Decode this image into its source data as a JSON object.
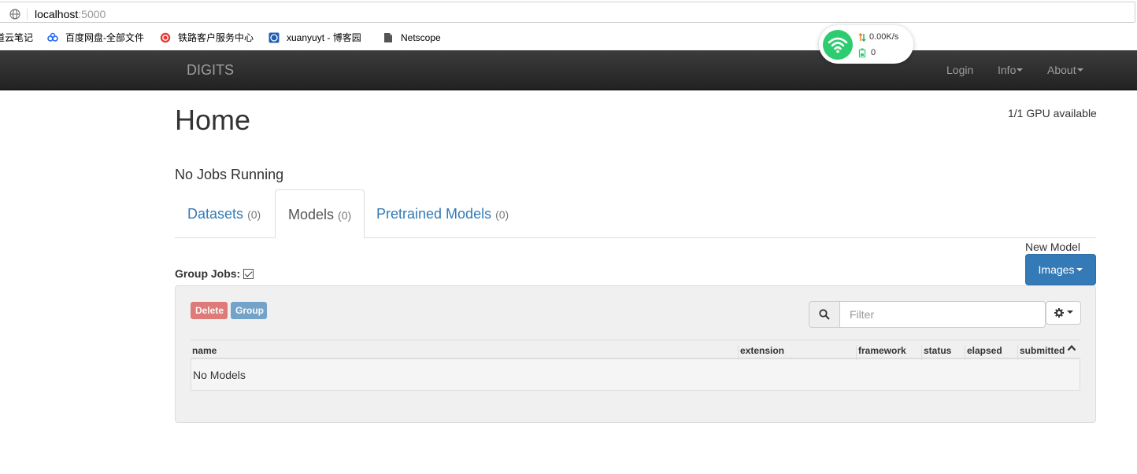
{
  "browser": {
    "url_host": "localhost",
    "url_port": ":5000",
    "bookmarks": [
      {
        "label": "道云笔记",
        "icon": "note-icon"
      },
      {
        "label": "百度网盘-全部文件",
        "icon": "baidu-cloud-icon"
      },
      {
        "label": "铁路客户服务中心",
        "icon": "railway-icon"
      },
      {
        "label": "xuanyuyt - 博客园",
        "icon": "cnblogs-icon"
      },
      {
        "label": "Netscope",
        "icon": "file-icon"
      }
    ]
  },
  "net_widget": {
    "speed": "0.00K/s",
    "count": "0",
    "color": "#2ecc71"
  },
  "navbar": {
    "brand": "DIGITS",
    "items": [
      "Login",
      "Info",
      "About"
    ]
  },
  "main": {
    "title": "Home",
    "gpu_status": "1/1 GPU available",
    "jobs_running": "No Jobs Running",
    "tabs": [
      {
        "label": "Datasets",
        "count": "(0)",
        "active": false
      },
      {
        "label": "Models",
        "count": "(0)",
        "active": true
      },
      {
        "label": "Pretrained Models",
        "count": "(0)",
        "active": false
      }
    ],
    "new_model_label": "New Model",
    "images_button": "Images",
    "group_jobs_label": "Group Jobs:",
    "group_jobs_checked": true,
    "delete_button": "Delete",
    "group_button": "Group",
    "filter_placeholder": "Filter",
    "table": {
      "columns": [
        "name",
        "extension",
        "framework",
        "status",
        "elapsed",
        "submitted"
      ],
      "empty_message": "No Models"
    }
  },
  "colors": {
    "primary": "#337ab7",
    "danger": "#d9534f",
    "navbar": "#222222"
  }
}
